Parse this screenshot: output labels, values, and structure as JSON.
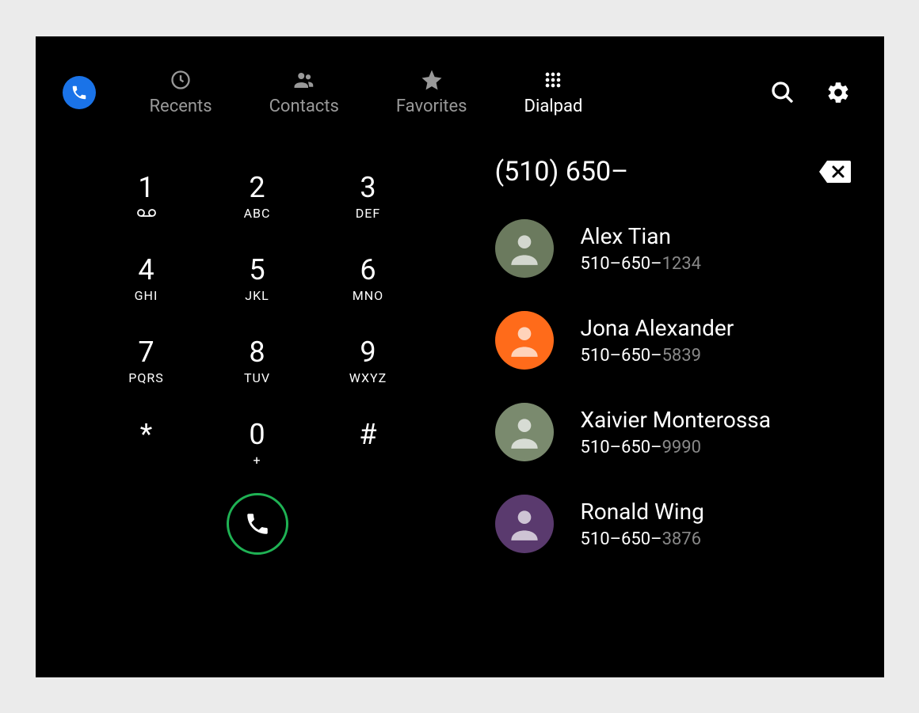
{
  "tabs": [
    {
      "label": "Recents",
      "active": false
    },
    {
      "label": "Contacts",
      "active": false
    },
    {
      "label": "Favorites",
      "active": false
    },
    {
      "label": "Dialpad",
      "active": true
    }
  ],
  "dialpad": {
    "keys": [
      {
        "digit": "1",
        "sub": "voicemail"
      },
      {
        "digit": "2",
        "sub": "ABC"
      },
      {
        "digit": "3",
        "sub": "DEF"
      },
      {
        "digit": "4",
        "sub": "GHI"
      },
      {
        "digit": "5",
        "sub": "JKL"
      },
      {
        "digit": "6",
        "sub": "MNO"
      },
      {
        "digit": "7",
        "sub": "PQRS"
      },
      {
        "digit": "8",
        "sub": "TUV"
      },
      {
        "digit": "9",
        "sub": "WXYZ"
      },
      {
        "digit": "*",
        "sub": ""
      },
      {
        "digit": "0",
        "sub": "+"
      },
      {
        "digit": "#",
        "sub": ""
      }
    ]
  },
  "dialed": "(510) 650–",
  "contacts": [
    {
      "name": "Alex Tian",
      "phone_prefix": "510–650–",
      "phone_suffix": "1234",
      "avatar_bg": "#6b7a5e"
    },
    {
      "name": "Jona Alexander",
      "phone_prefix": "510–650–",
      "phone_suffix": "5839",
      "avatar_bg": "#ff6b1a"
    },
    {
      "name": "Xaivier Monterossa",
      "phone_prefix": "510–650–",
      "phone_suffix": "9990",
      "avatar_bg": "#7a8a6e"
    },
    {
      "name": "Ronald Wing",
      "phone_prefix": "510–650–",
      "phone_suffix": "3876",
      "avatar_bg": "#5a3a6e"
    }
  ]
}
